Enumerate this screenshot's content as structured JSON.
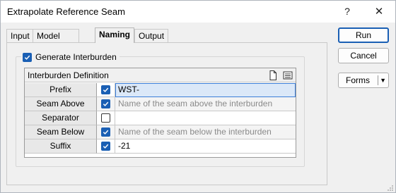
{
  "window": {
    "title": "Extrapolate Reference Seam",
    "help_glyph": "?",
    "close_glyph": "✕"
  },
  "tabs": [
    {
      "label": "Input",
      "active": false
    },
    {
      "label": "Model Thickness",
      "active": false
    },
    {
      "label": "Naming",
      "active": true
    },
    {
      "label": "Output",
      "active": false
    }
  ],
  "naming": {
    "generate_label": "Generate Interburden",
    "generate_checked": true,
    "grid_title": "Interburden Definition",
    "header_icons": [
      "document-icon",
      "list-icon"
    ],
    "rows": [
      {
        "label": "Prefix",
        "checked": true,
        "value": "WST-",
        "placeholder": false,
        "selected": true
      },
      {
        "label": "Seam Above",
        "checked": true,
        "value": "Name of the seam above the interburden",
        "placeholder": true,
        "selected": false
      },
      {
        "label": "Separator",
        "checked": false,
        "value": "",
        "placeholder": false,
        "selected": false
      },
      {
        "label": "Seam Below",
        "checked": true,
        "value": "Name of the seam below the interburden",
        "placeholder": true,
        "selected": false
      },
      {
        "label": "Suffix",
        "checked": true,
        "value": "-21",
        "placeholder": false,
        "selected": false
      }
    ]
  },
  "buttons": {
    "run": "Run",
    "cancel": "Cancel",
    "forms": "Forms"
  },
  "colors": {
    "accent": "#1a5fb4",
    "selection_bg": "#dbe8f8",
    "placeholder_text": "#8a8a8a"
  }
}
